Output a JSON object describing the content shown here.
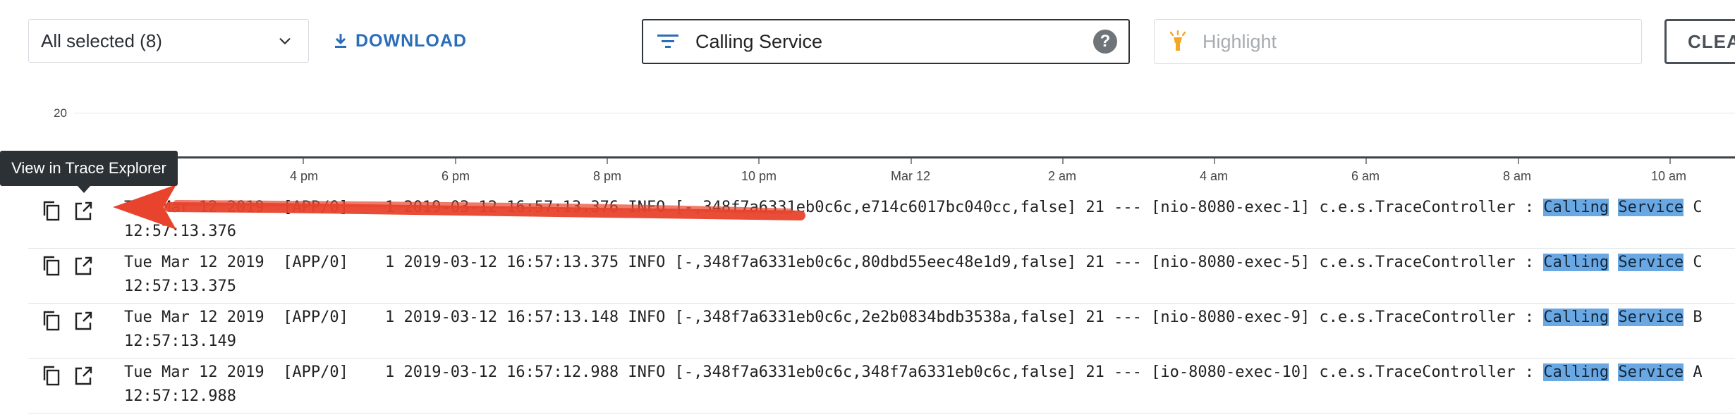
{
  "toolbar": {
    "select_label": "All selected (8)",
    "download_label": "DOWNLOAD",
    "filter_value": "Calling Service",
    "help_glyph": "?",
    "highlight_placeholder": "Highlight",
    "clear_label": "CLEA"
  },
  "chart": {
    "y_tick": "20",
    "x_ticks": [
      "4 pm",
      "6 pm",
      "8 pm",
      "10 pm",
      "Mar 12",
      "2 am",
      "4 am",
      "6 am",
      "8 am",
      "10 am"
    ]
  },
  "tooltip": "View in Trace Explorer",
  "logs": [
    {
      "date": "Tue Mar 12 2019",
      "source": "[APP/0]",
      "time": "12:57:13.376",
      "message_prefix": "1 2019-03-12 16:57:13.376 INFO [-,348f7a6331eb0c6c,e714c6017bc040cc,false] 21 --- [nio-8080-exec-1] c.e.s.TraceController : ",
      "hl1": "Calling",
      "hl2": "Service",
      "suffix": "C"
    },
    {
      "date": "Tue Mar 12 2019",
      "source": "[APP/0]",
      "time": "12:57:13.375",
      "message_prefix": "1 2019-03-12 16:57:13.375 INFO [-,348f7a6331eb0c6c,80dbd55eec48e1d9,false] 21 --- [nio-8080-exec-5] c.e.s.TraceController : ",
      "hl1": "Calling",
      "hl2": "Service",
      "suffix": "C"
    },
    {
      "date": "Tue Mar 12 2019",
      "source": "[APP/0]",
      "time": "12:57:13.149",
      "message_prefix": "1 2019-03-12 16:57:13.148 INFO [-,348f7a6331eb0c6c,2e2b0834bdb3538a,false] 21 --- [nio-8080-exec-9] c.e.s.TraceController : ",
      "hl1": "Calling",
      "hl2": "Service",
      "suffix": "B"
    },
    {
      "date": "Tue Mar 12 2019",
      "source": "[APP/0]",
      "time": "12:57:12.988",
      "message_prefix": "1 2019-03-12 16:57:12.988 INFO [-,348f7a6331eb0c6c,348f7a6331eb0c6c,false] 21 --- [io-8080-exec-10] c.e.s.TraceController : ",
      "hl1": "Calling",
      "hl2": "Service",
      "suffix": "A"
    }
  ],
  "icons": {
    "chevron": "chevron-down-icon",
    "download": "download-icon",
    "filter": "filter-icon",
    "help": "help-icon",
    "highlight": "highlighter-icon",
    "copy": "copy-icon",
    "open": "open-in-new-icon"
  },
  "colors": {
    "accent": "#2a6db8",
    "highlight": "#6aa8e4",
    "annotation": "#e8432c",
    "highlighter_icon": "#f5a623"
  }
}
